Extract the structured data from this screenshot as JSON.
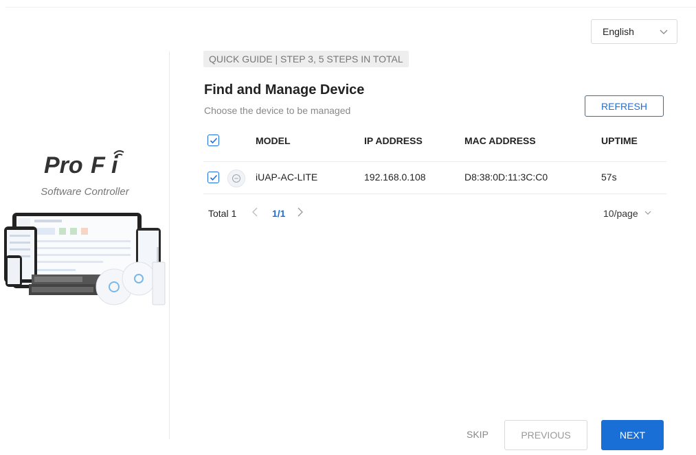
{
  "language": {
    "selected": "English",
    "icon": "chevron-down-icon"
  },
  "brand": {
    "logo_text": "ProFi",
    "subtitle": "Software Controller"
  },
  "guide": {
    "step_badge": "QUICK GUIDE | STEP 3, 5 STEPS IN TOTAL",
    "title": "Find and Manage Device",
    "description": "Choose the device to be managed",
    "refresh_label": "REFRESH"
  },
  "table": {
    "columns": [
      "MODEL",
      "IP ADDRESS",
      "MAC ADDRESS",
      "UPTIME"
    ],
    "rows": [
      {
        "checked": true,
        "icon": "access-point-icon",
        "model": "iUAP-AC-LITE",
        "ip": "192.168.0.108",
        "mac": "D8:38:0D:11:3C:C0",
        "uptime": "57s"
      }
    ]
  },
  "pagination": {
    "total_label": "Total 1",
    "page": "1/1",
    "page_size": "10/page"
  },
  "footer": {
    "skip_label": "SKIP",
    "previous_label": "PREVIOUS",
    "next_label": "NEXT"
  },
  "colors": {
    "accent": "#1a6fd6",
    "muted": "#888888"
  }
}
